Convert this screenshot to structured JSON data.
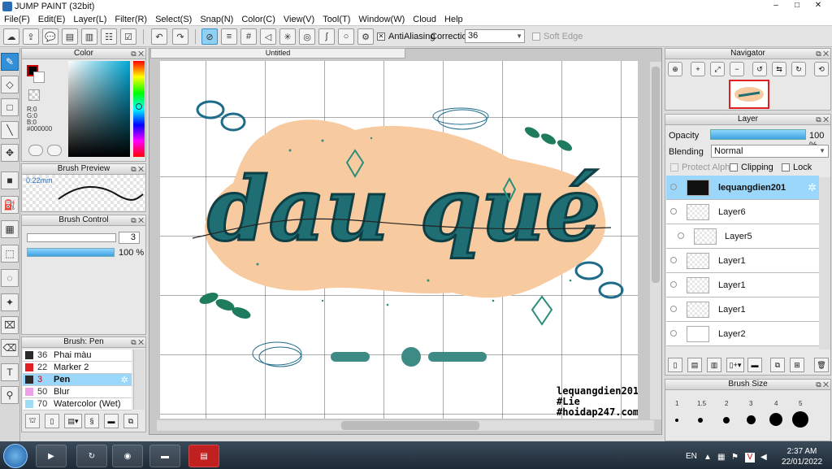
{
  "window": {
    "title": "JUMP PAINT (32bit)",
    "min": "–",
    "max": "□",
    "close": "✕"
  },
  "menu": [
    "File(F)",
    "Edit(E)",
    "Layer(L)",
    "Filter(R)",
    "Select(S)",
    "Snap(N)",
    "Color(C)",
    "View(V)",
    "Tool(T)",
    "Window(W)",
    "Cloud",
    "Help"
  ],
  "toolbar": {
    "antialiasing_label": "AntiAliasing",
    "antialiasing_checked": true,
    "correction_label": "Correction",
    "correction_value": "36",
    "soft_edge_label": "Soft Edge",
    "soft_edge_checked": false
  },
  "color_panel": {
    "title": "Color",
    "r": "R:0",
    "g": "G:0",
    "b": "B:0",
    "hex": "#000000",
    "fg_color": "#000000",
    "bg_color": "#ffffff"
  },
  "brush_preview": {
    "title": "Brush Preview",
    "size": "0.22mm"
  },
  "brush_control": {
    "title": "Brush Control",
    "size": "3",
    "opacity": "100 %"
  },
  "brush_list": {
    "title": "Brush: Pen",
    "items": [
      {
        "num": "36",
        "name": "Phai màu",
        "color": "#2a2a2a",
        "selected": false
      },
      {
        "num": "22",
        "name": "Marker 2",
        "color": "#e02020",
        "selected": false
      },
      {
        "num": "3",
        "name": "Pen",
        "color": "#2a2a2a",
        "selected": true
      },
      {
        "num": "50",
        "name": "Blur",
        "color": "#f0a0e8",
        "selected": false
      },
      {
        "num": "70",
        "name": "Watercolor (Wet)",
        "color": "#9fdcf5",
        "selected": false
      }
    ]
  },
  "document": {
    "tab": "Untitled",
    "artwork_text": "dau qué",
    "signature_lines": [
      "lequangdien201",
      "#Lie",
      "#hoidap247.com"
    ]
  },
  "navigator": {
    "title": "Navigator"
  },
  "layer_panel": {
    "title": "Layer",
    "opacity_label": "Opacity",
    "opacity_value": "100 %",
    "blending_label": "Blending",
    "blending_value": "Normal",
    "protect_alpha": "Protect Alpha",
    "clipping": "Clipping",
    "lock": "Lock",
    "layers": [
      {
        "name": "lequangdien201",
        "selected": true
      },
      {
        "name": "Layer6",
        "selected": false
      },
      {
        "name": "Layer5",
        "selected": false
      },
      {
        "name": "Layer1",
        "selected": false
      },
      {
        "name": "Layer1",
        "selected": false
      },
      {
        "name": "Layer1",
        "selected": false
      },
      {
        "name": "Layer2",
        "selected": false
      }
    ]
  },
  "brush_size_panel": {
    "title": "Brush Size",
    "sizes": [
      "1",
      "1.5",
      "2",
      "3",
      "4",
      "5"
    ]
  },
  "taskbar": {
    "language": "EN",
    "time": "2:37 AM",
    "date": "22/01/2022"
  }
}
